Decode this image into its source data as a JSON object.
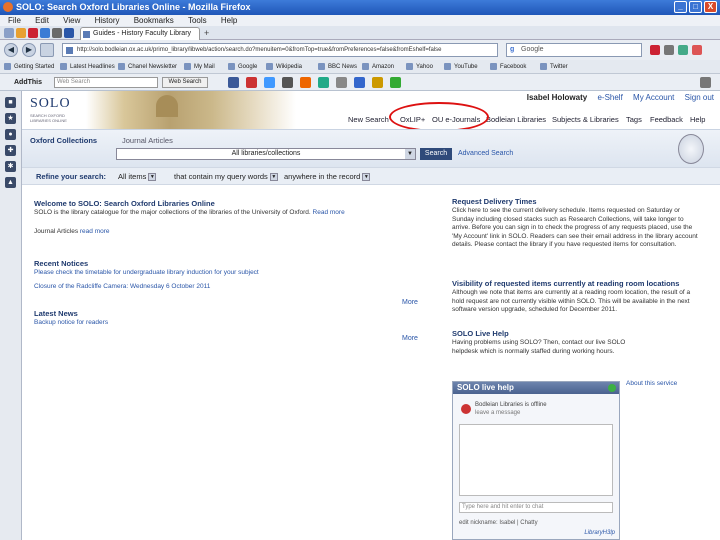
{
  "window": {
    "title": "SOLO: Search Oxford Libraries Online - Mozilla Firefox",
    "controls": [
      "_",
      "□",
      "X"
    ]
  },
  "menubar": [
    "File",
    "Edit",
    "View",
    "History",
    "Bookmarks",
    "Tools",
    "Help"
  ],
  "tabs": {
    "active_label": "Guides - History Faculty Library",
    "new_tab": "+"
  },
  "nav": {
    "back": "◀",
    "forward": "▶",
    "url": "http://solo.bodleian.ox.ac.uk/primo_library/libweb/action/search.do?menuitem=0&fromTop=true&fromPreferences=false&fromEshelf=false",
    "search_placeholder": "Google"
  },
  "bookmarks": [
    "Getting Started",
    "Latest Headlines",
    "Chanel Newsletter",
    "My Mail",
    "Google",
    "Wikipedia",
    "BBC News",
    "Amazon",
    "Yahoo",
    "YouTube",
    "Facebook",
    "Twitter"
  ],
  "addon": {
    "label": "AddThis",
    "input_placeholder": "Web Search",
    "button": "Web Search"
  },
  "header": {
    "logo": "SOLO",
    "logo_sub": "SEARCH OXFORD LIBRARIES ONLINE",
    "user_name": "Isabel Holowaty",
    "eshelf": "e-Shelf",
    "my_account": "My Account",
    "signout": "Sign out"
  },
  "topnav": [
    "New Search",
    "OxLIP+",
    "OU e-Journals",
    "Bodleian Libraries",
    "Subjects & Libraries",
    "Tags",
    "Feedback",
    "Help"
  ],
  "search": {
    "tab_oxford": "Oxford Collections",
    "tab_journal": "Journal Articles",
    "scope": "All libraries/collections",
    "button": "Search",
    "advanced": "Advanced Search"
  },
  "refine": {
    "label": "Refine your search:",
    "type": "All items",
    "field": "that contain my query words",
    "where": "anywhere in the record"
  },
  "left": {
    "welcome_title": "Welcome to SOLO: Search Oxford Libraries Online",
    "welcome_text": "SOLO is the library catalogue for the major collections of the libraries of the University of Oxford.",
    "welcome_link": "Read more",
    "journal_label": "Journal Articles",
    "journal_link": "read more",
    "notices_title": "Recent Notices",
    "notice_1": "Please check the timetable for undergraduate library induction for your subject",
    "notice_2": "Closure of the Radcliffe Camera: Wednesday 6 October 2011",
    "more": "More",
    "news_title": "Latest News",
    "news_1": "Backup notice for readers",
    "more2": "More"
  },
  "right": {
    "delivery_title": "Request Delivery Times",
    "delivery_text": "Click here to see the current delivery schedule. Items requested on Saturday or Sunday including closed stacks such as Research Collections, will take longer to arrive. Before you can sign in to check the progress of any requests placed, use the 'My Account' link in SOLO. Readers can see their email address in the library account details. Please contact the library if you have requested items for consultation.",
    "visibility_title": "Visibility of requested items currently at reading room locations",
    "visibility_text": "Although we note that items are currently at a reading room location, the result of a hold request are not currently visible within SOLO. This will be available in the next software version upgrade, scheduled for December 2011.",
    "help_title": "SOLO Live Help",
    "help_text": "Having problems using SOLO? Then, contact our live SOLO helpdesk which is normally staffed during working hours."
  },
  "livehelp": {
    "title": "SOLO live help",
    "status": "Bodleian Libraries is offline",
    "leave": "leave a message",
    "input_placeholder": "Type here and hit enter to chat",
    "footer": "edit nickname: Isabel | Chatty",
    "logo": "LibraryH3lp",
    "about": "About this service"
  },
  "colors": {
    "highlight_ring": "#dd1111",
    "brand": "#1f3a6e",
    "link": "#2a56a8"
  }
}
